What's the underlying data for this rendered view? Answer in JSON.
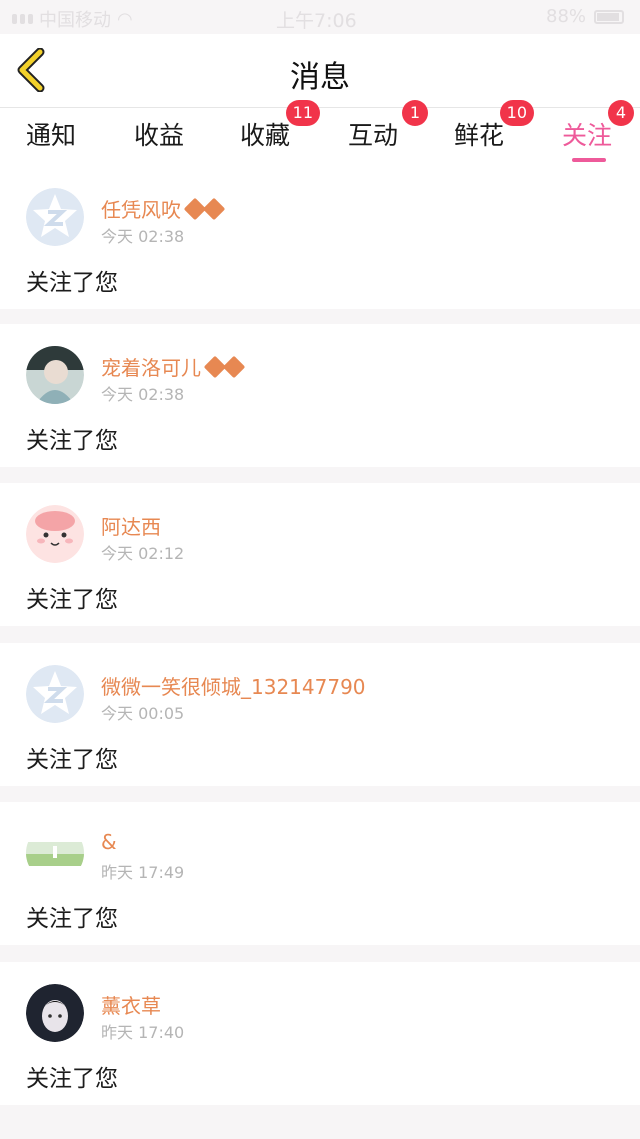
{
  "status_bar": {
    "carrier": "中国移动",
    "time": "上午7:06",
    "battery": "88%"
  },
  "header": {
    "title": "消息"
  },
  "tabs": [
    {
      "label": "通知",
      "badge": ""
    },
    {
      "label": "收益",
      "badge": ""
    },
    {
      "label": "收藏",
      "badge": "11"
    },
    {
      "label": "互动",
      "badge": "1"
    },
    {
      "label": "鲜花",
      "badge": "10"
    },
    {
      "label": "关注",
      "badge": "4",
      "active": true
    }
  ],
  "messages": [
    {
      "username": "任凭风吹",
      "vip": true,
      "time": "今天 02:38",
      "text": "关注了您",
      "avatar": "default-avatar"
    },
    {
      "username": "宠着洛可儿",
      "vip": true,
      "time": "今天 02:38",
      "text": "关注了您",
      "avatar": "photo-avatar"
    },
    {
      "username": "阿达西",
      "vip": false,
      "time": "今天 02:12",
      "text": "关注了您",
      "avatar": "cartoon-avatar"
    },
    {
      "username": "微微一笑很倾城_132147790",
      "vip": false,
      "time": "今天 00:05",
      "text": "关注了您",
      "avatar": "default-avatar"
    },
    {
      "username": "&",
      "vip": false,
      "time": "昨天 17:49",
      "text": "关注了您",
      "avatar": "landscape-avatar"
    },
    {
      "username": "薰衣草",
      "vip": false,
      "time": "昨天 17:40",
      "text": "关注了您",
      "avatar": "portrait-avatar"
    }
  ],
  "colors": {
    "accent": "#ee5a9a",
    "badge": "#f1344a",
    "username": "#e78852",
    "back_arrow": "#f3d12a"
  }
}
